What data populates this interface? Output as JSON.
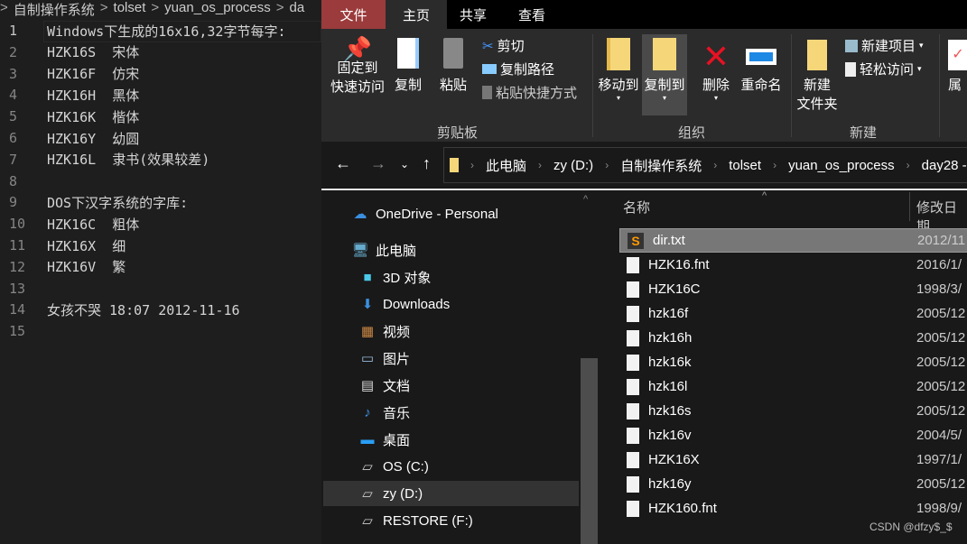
{
  "editor": {
    "breadcrumb": [
      "自制操作系统",
      "tolset",
      "yuan_os_process",
      "da"
    ],
    "lines": [
      {
        "n": "1",
        "t": "Windows下生成的16x16,32字节每字:"
      },
      {
        "n": "2",
        "t": "HZK16S  宋体"
      },
      {
        "n": "3",
        "t": "HZK16F  仿宋"
      },
      {
        "n": "4",
        "t": "HZK16H  黑体"
      },
      {
        "n": "5",
        "t": "HZK16K  楷体"
      },
      {
        "n": "6",
        "t": "HZK16Y  幼圆"
      },
      {
        "n": "7",
        "t": "HZK16L  隶书(效果较差)"
      },
      {
        "n": "8",
        "t": ""
      },
      {
        "n": "9",
        "t": "DOS下汉字系统的字库:"
      },
      {
        "n": "10",
        "t": "HZK16C  粗体"
      },
      {
        "n": "11",
        "t": "HZK16X  细"
      },
      {
        "n": "12",
        "t": "HZK16V  繁"
      },
      {
        "n": "13",
        "t": ""
      },
      {
        "n": "14",
        "t": "女孩不哭 18:07 2012-11-16"
      },
      {
        "n": "15",
        "t": ""
      }
    ]
  },
  "explorer": {
    "tabs": [
      "文件",
      "主页",
      "共享",
      "查看"
    ],
    "ribbon": {
      "pin": [
        "固定到",
        "快速访问"
      ],
      "copy": "复制",
      "paste": "粘贴",
      "cut": "剪切",
      "copy_path": "复制路径",
      "paste_shortcut": "粘贴快捷方式",
      "move_to": "移动到",
      "copy_to": "复制到",
      "delete": "删除",
      "rename": "重命名",
      "new_folder": [
        "新建",
        "文件夹"
      ],
      "new_item": "新建项目",
      "easy_access": "轻松访问",
      "properties": "属",
      "groups": {
        "clipboard": "剪贴板",
        "organize": "组织",
        "new": "新建"
      }
    },
    "address": [
      "此电脑",
      "zy (D:)",
      "自制操作系统",
      "tolset",
      "yuan_os_process",
      "day28 -"
    ],
    "nav": [
      {
        "label": "OneDrive - Personal",
        "icon": "cloud-icon"
      },
      {
        "label": "此电脑",
        "icon": "computer-icon"
      },
      {
        "label": "3D 对象",
        "icon": "cube-icon"
      },
      {
        "label": "Downloads",
        "icon": "download-icon"
      },
      {
        "label": "视频",
        "icon": "video-icon"
      },
      {
        "label": "图片",
        "icon": "picture-icon"
      },
      {
        "label": "文档",
        "icon": "document-icon"
      },
      {
        "label": "音乐",
        "icon": "music-icon"
      },
      {
        "label": "桌面",
        "icon": "desktop-icon"
      },
      {
        "label": "OS (C:)",
        "icon": "drive-icon"
      },
      {
        "label": "zy (D:)",
        "icon": "drive-icon",
        "selected": true
      },
      {
        "label": "RESTORE (F:)",
        "icon": "drive-icon"
      }
    ],
    "columns": {
      "name": "名称",
      "date": "修改日期"
    },
    "files": [
      {
        "name": "dir.txt",
        "date": "2012/11"
      },
      {
        "name": "HZK16.fnt",
        "date": "2016/1/"
      },
      {
        "name": "HZK16C",
        "date": "1998/3/"
      },
      {
        "name": "hzk16f",
        "date": "2005/12"
      },
      {
        "name": "hzk16h",
        "date": "2005/12"
      },
      {
        "name": "hzk16k",
        "date": "2005/12"
      },
      {
        "name": "hzk16l",
        "date": "2005/12"
      },
      {
        "name": "hzk16s",
        "date": "2005/12"
      },
      {
        "name": "hzk16v",
        "date": "2004/5/"
      },
      {
        "name": "HZK16X",
        "date": "1997/1/"
      },
      {
        "name": "hzk16y",
        "date": "2005/12"
      },
      {
        "name": "HZK160.fnt",
        "date": "1998/9/"
      }
    ],
    "watermark": "CSDN @dfzy$_$",
    "colors": {
      "file_tab": "#9b3b3b",
      "accent": "#0078d7"
    }
  }
}
